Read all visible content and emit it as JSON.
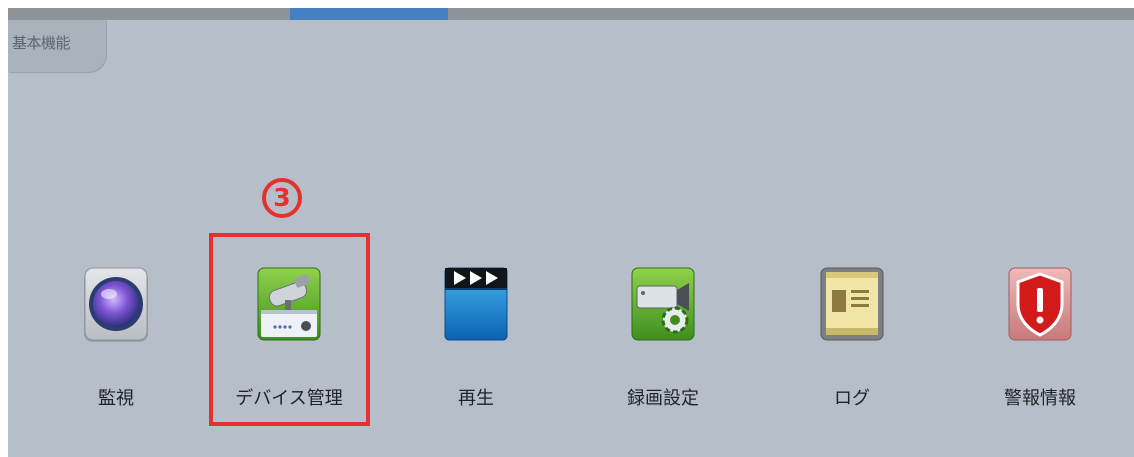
{
  "section": {
    "title": "基本機能"
  },
  "annotation": {
    "step_number": "3",
    "color": "#e53030"
  },
  "accent_color": "#4581c3",
  "apps": [
    {
      "label": "監視",
      "icon": "camera-lens-icon"
    },
    {
      "label": "デバイス管理",
      "icon": "cctv-device-icon"
    },
    {
      "label": "再生",
      "icon": "clapperboard-icon"
    },
    {
      "label": "録画設定",
      "icon": "camera-settings-icon"
    },
    {
      "label": "ログ",
      "icon": "log-book-icon"
    },
    {
      "label": "警報情報",
      "icon": "alarm-shield-icon"
    }
  ]
}
